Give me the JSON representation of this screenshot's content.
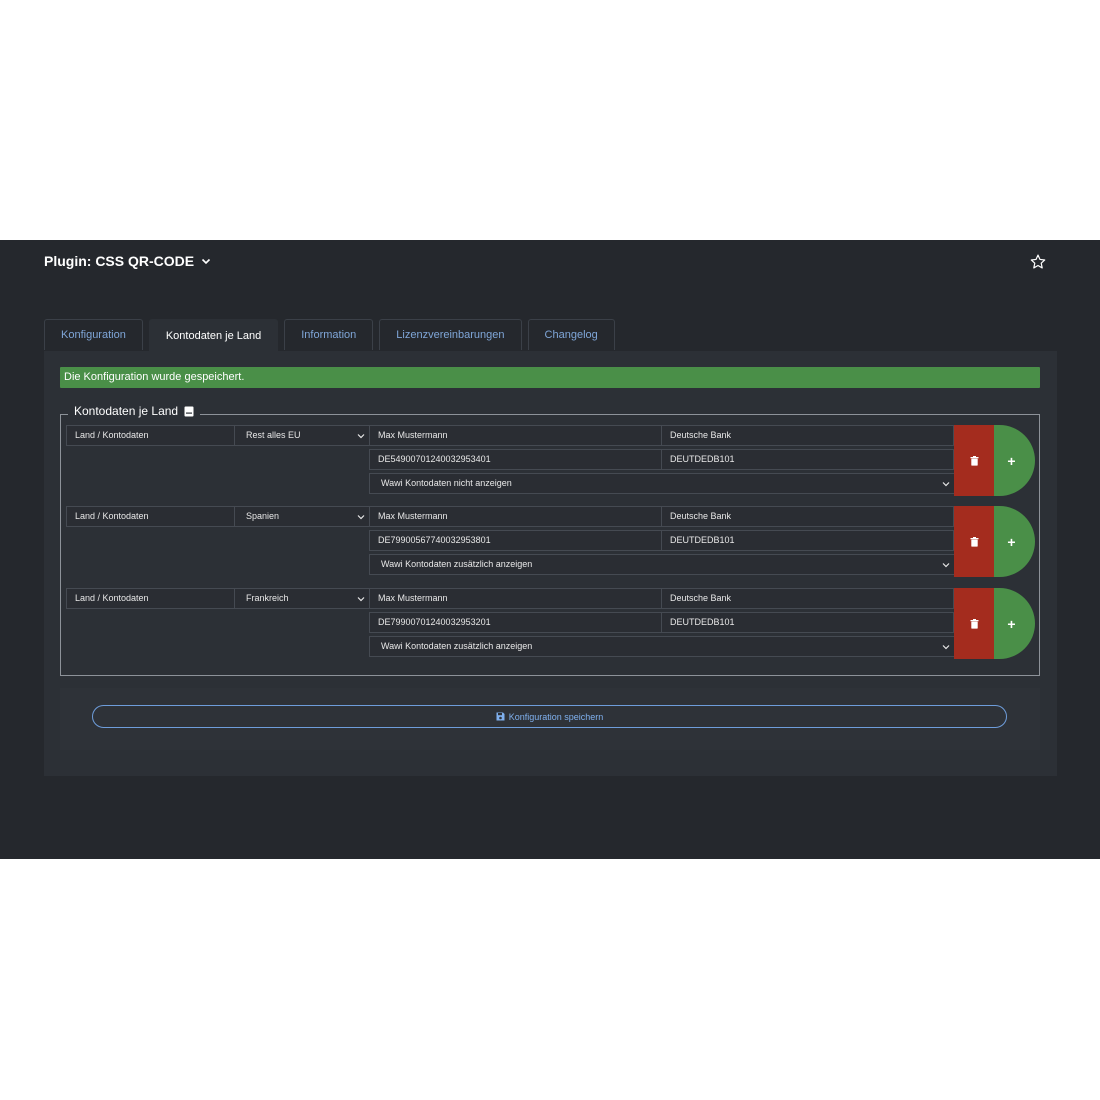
{
  "header": {
    "title": "Plugin: CSS QR-CODE",
    "title_icon": "chevron-down-icon",
    "favorite_icon": "star-icon"
  },
  "tabs": [
    {
      "label": "Konfiguration",
      "active": false
    },
    {
      "label": "Kontodaten je Land",
      "active": true
    },
    {
      "label": "Information",
      "active": false
    },
    {
      "label": "Lizenzvereinbarungen",
      "active": false
    },
    {
      "label": "Changelog",
      "active": false
    }
  ],
  "alert": {
    "text": "Die Konfiguration wurde gespeichert.",
    "color": "#4a8f48"
  },
  "section": {
    "legend": "Kontodaten je Land",
    "legend_icon": "book-icon"
  },
  "rows": [
    {
      "label": "Land / Kontodaten",
      "country": "Rest alles EU",
      "name": "Max Mustermann",
      "bank": "Deutsche Bank",
      "iban": "DE54900701240032953401",
      "bic": "DEUTDEDB101",
      "wawi_option": "Wawi Kontodaten nicht anzeigen"
    },
    {
      "label": "Land / Kontodaten",
      "country": "Spanien",
      "name": "Max Mustermann",
      "bank": "Deutsche Bank",
      "iban": "DE79900567740032953801",
      "bic": "DEUTDEDB101",
      "wawi_option": "Wawi Kontodaten zusätzlich anzeigen"
    },
    {
      "label": "Land / Kontodaten",
      "country": "Frankreich",
      "name": "Max Mustermann",
      "bank": "Deutsche Bank",
      "iban": "DE79900701240032953201",
      "bic": "DEUTDEDB101",
      "wawi_option": "Wawi Kontodaten zusätzlich anzeigen"
    }
  ],
  "row_actions": {
    "delete_icon": "trash-icon",
    "add_label": "+",
    "delete_color": "#a42c1e",
    "add_color": "#4a8f48"
  },
  "footer": {
    "save_label": "Konfiguration speichern",
    "save_icon": "floppy-disk-icon"
  }
}
